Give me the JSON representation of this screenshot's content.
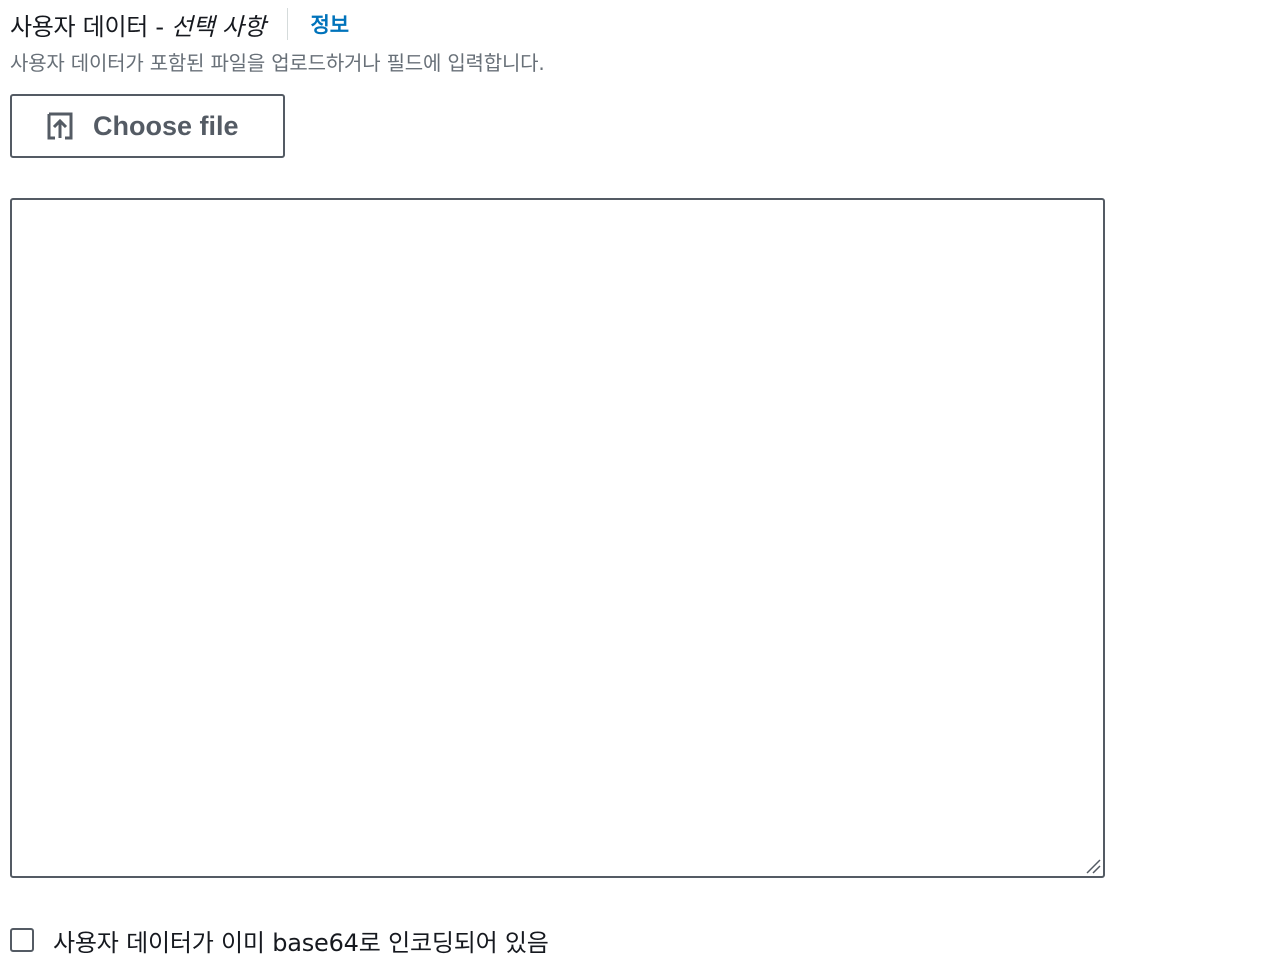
{
  "field": {
    "label": "사용자 데이터 - ",
    "optional": "선택 사항",
    "info_link": "정보",
    "description": "사용자 데이터가 포함된 파일을 업로드하거나 필드에 입력합니다."
  },
  "upload": {
    "button_label": "Choose file",
    "icon": "upload-icon"
  },
  "textarea": {
    "value": "",
    "resize_icon": "resize-handle-icon"
  },
  "base64_checkbox": {
    "label": "사용자 데이터가 이미 base64로 인코딩되어 있음",
    "checked": false
  },
  "colors": {
    "text": "#16191f",
    "secondary_text": "#687078",
    "link": "#0073bb",
    "border": "#545b64",
    "divider": "#d5dbdb"
  }
}
